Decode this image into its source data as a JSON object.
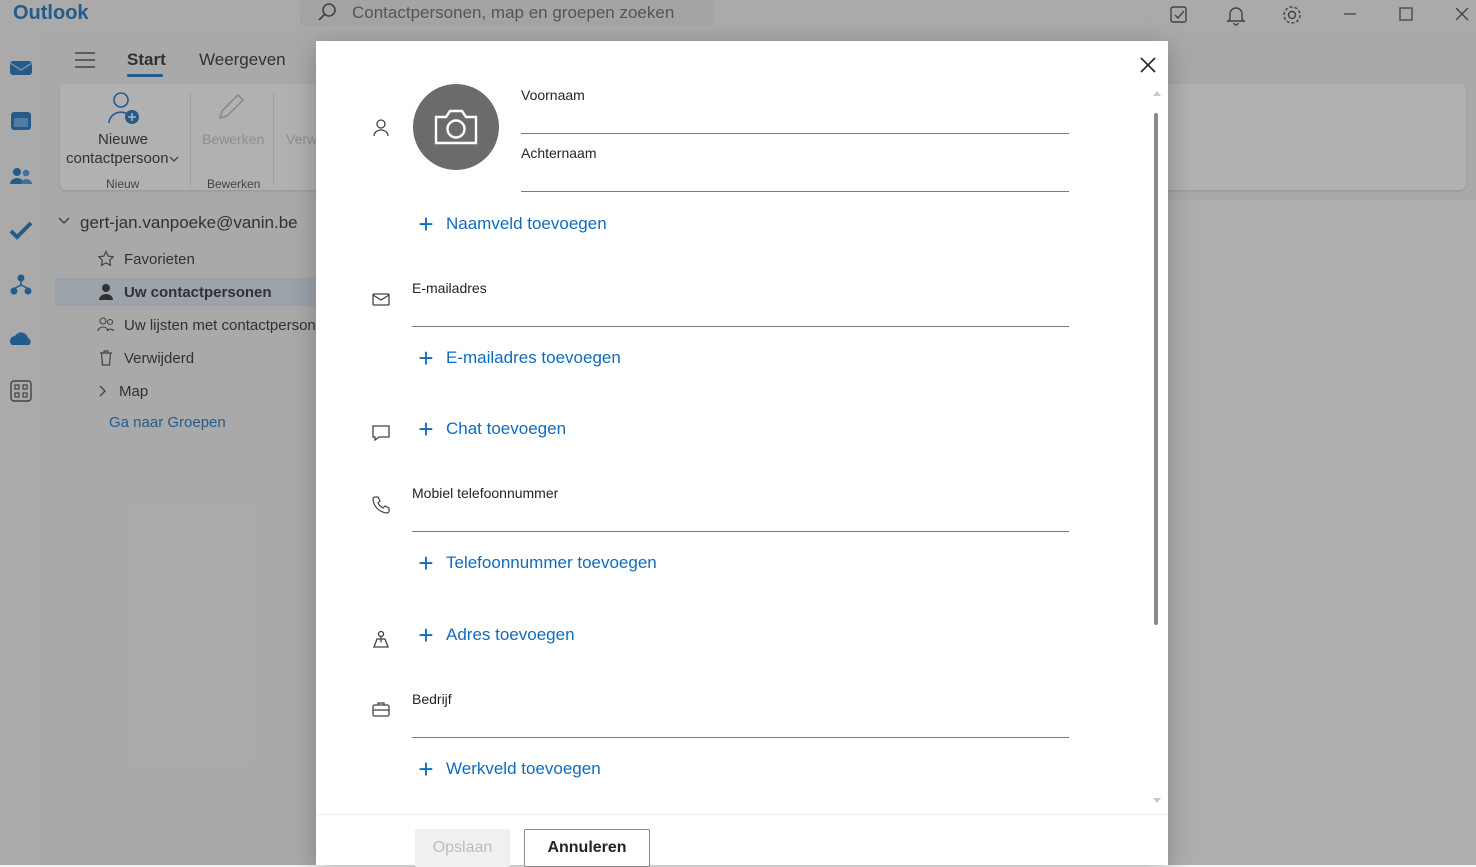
{
  "app": {
    "title": "Outlook"
  },
  "search": {
    "placeholder": "Contactpersonen, map en groepen zoeken"
  },
  "titlebar_icons": [
    "notes-icon",
    "bell-icon",
    "gear-icon",
    "minimize-icon",
    "maximize-icon",
    "close-icon"
  ],
  "ribbon": {
    "tabs": [
      {
        "label": "Start"
      },
      {
        "label": "Weergeven"
      }
    ],
    "new_contact_line1": "Nieuwe",
    "new_contact_line2": "contactpersoon",
    "group_new": "Nieuw",
    "edit_label": "Bewerken",
    "group_edit": "Bewerken",
    "delete_partial": "Verw"
  },
  "nav": {
    "account": "gert-jan.vanpoeke@vanin.be",
    "items": [
      {
        "label": "Favorieten"
      },
      {
        "label": "Uw contactpersonen"
      },
      {
        "label": "Uw lijsten met contactpersonen"
      },
      {
        "label": "Verwijderd"
      },
      {
        "label": "Map"
      }
    ],
    "goto_groups": "Ga naar Groepen"
  },
  "dialog": {
    "first_name_label": "Voornaam",
    "last_name_label": "Achternaam",
    "add_name_field": "Naamveld toevoegen",
    "email_label": "E-mailadres",
    "add_email": "E-mailadres toevoegen",
    "add_chat": "Chat toevoegen",
    "mobile_label": "Mobiel telefoonnummer",
    "add_phone": "Telefoonnummer toevoegen",
    "add_address": "Adres toevoegen",
    "company_label": "Bedrijf",
    "add_work_field": "Werkveld toevoegen",
    "save_label": "Opslaan",
    "cancel_label": "Annuleren"
  },
  "colors": {
    "accent": "#0f6cbd",
    "avatar": "#6b6b6b"
  }
}
